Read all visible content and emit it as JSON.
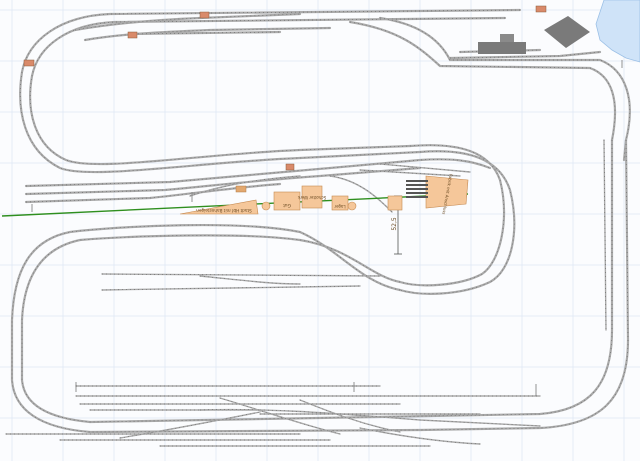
{
  "canvas": {
    "background": "#fbfcfe",
    "grid_color": "#dfe7f5"
  },
  "colors": {
    "track": "#a9a9a9",
    "ground_line": "#2f8f1f",
    "building_fill": "#f5c79a",
    "building_stroke": "#c58a52",
    "dark_building": "#7a7a7a",
    "water": "#cfe3f8"
  },
  "labels": {
    "station_building": "Stadt Hbf mit Bahnsteigen",
    "warehouse": "Gut",
    "gravel_plant": "Schotter Werk",
    "goods_shed": "Lager",
    "factory_block": "Fabrik mit Anschluss",
    "dimension": "52,5"
  }
}
